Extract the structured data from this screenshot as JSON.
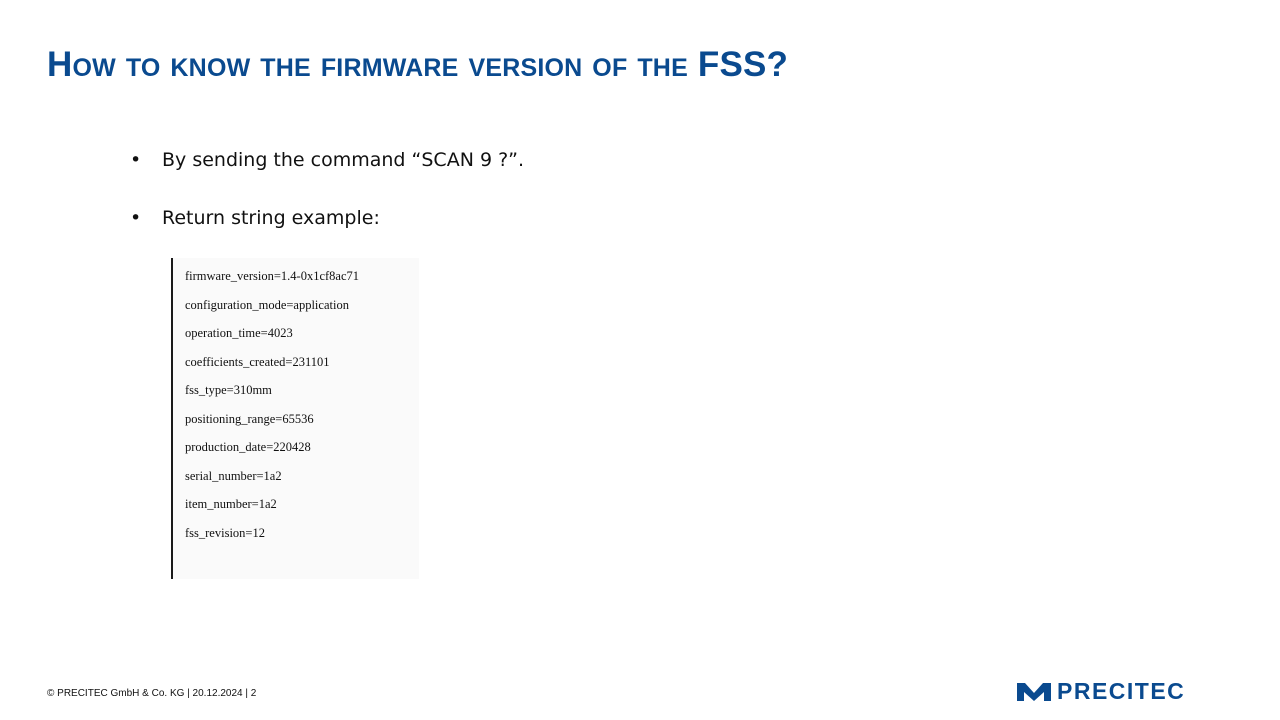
{
  "slide": {
    "title": "How to know the firmware version of the FSS?"
  },
  "bullets": [
    {
      "text": "By sending the command “SCAN 9 ?”."
    },
    {
      "text": "Return string example:"
    }
  ],
  "return_string": [
    "firmware_version=1.4-0x1cf8ac71",
    "configuration_mode=application",
    "operation_time=4023",
    "coefficients_created=231101",
    "fss_type=310mm",
    "positioning_range=65536",
    "production_date=220428",
    "serial_number=1a2",
    "item_number=1a2",
    "fss_revision=12"
  ],
  "footer": {
    "copyright": "© PRECITEC GmbH & Co. KG | 20.12.2024 | 2"
  },
  "logo": {
    "text": "PRECITEC",
    "icon": "precitec-logo-mark",
    "color": "#0a4a8f"
  },
  "colors": {
    "title": "#0a4a8f",
    "text": "#111111"
  }
}
